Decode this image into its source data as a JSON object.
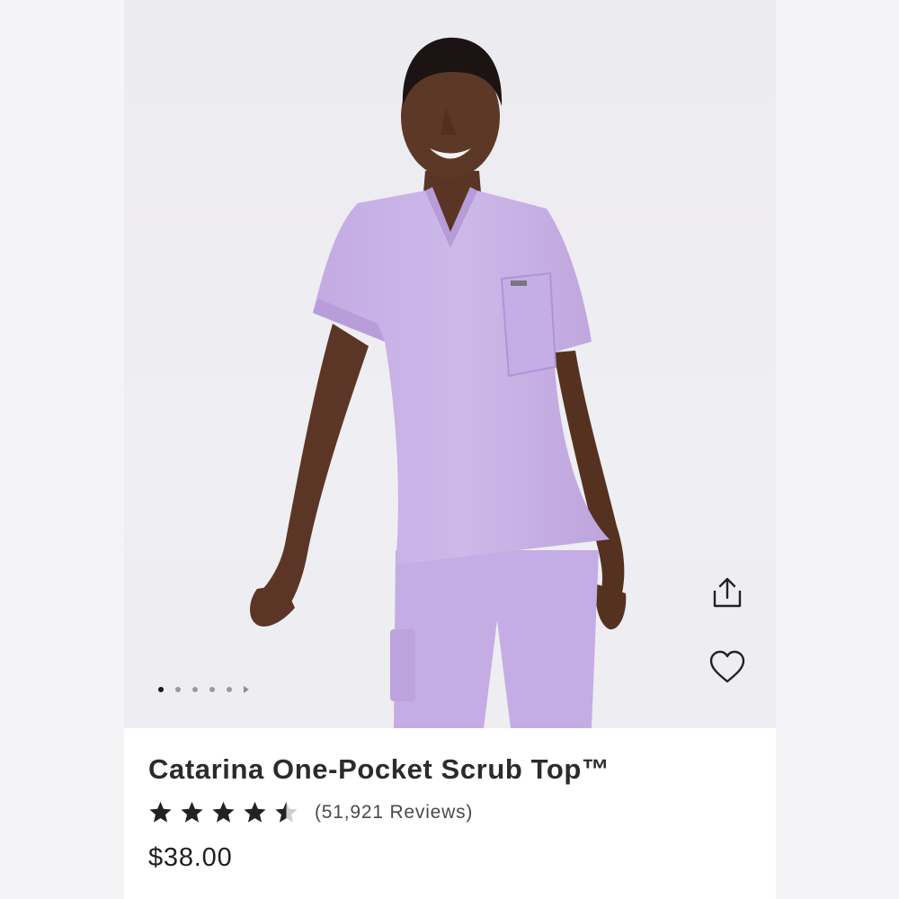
{
  "product": {
    "title": "Catarina One-Pocket Scrub Top™",
    "rating": 4.5,
    "review_count_label": "(51,921 Reviews)",
    "price": "$38.00"
  },
  "gallery": {
    "image_count": 5,
    "active_index": 0,
    "photo_colors": {
      "background": "#eeedf1",
      "scrubs": "#c9b3e6",
      "skin": "#5a3525"
    }
  },
  "actions": {
    "share_icon": "share-icon",
    "wishlist_icon": "heart-outline-icon"
  },
  "colors": {
    "text_primary": "#2b2b2b",
    "star": "#222222"
  }
}
